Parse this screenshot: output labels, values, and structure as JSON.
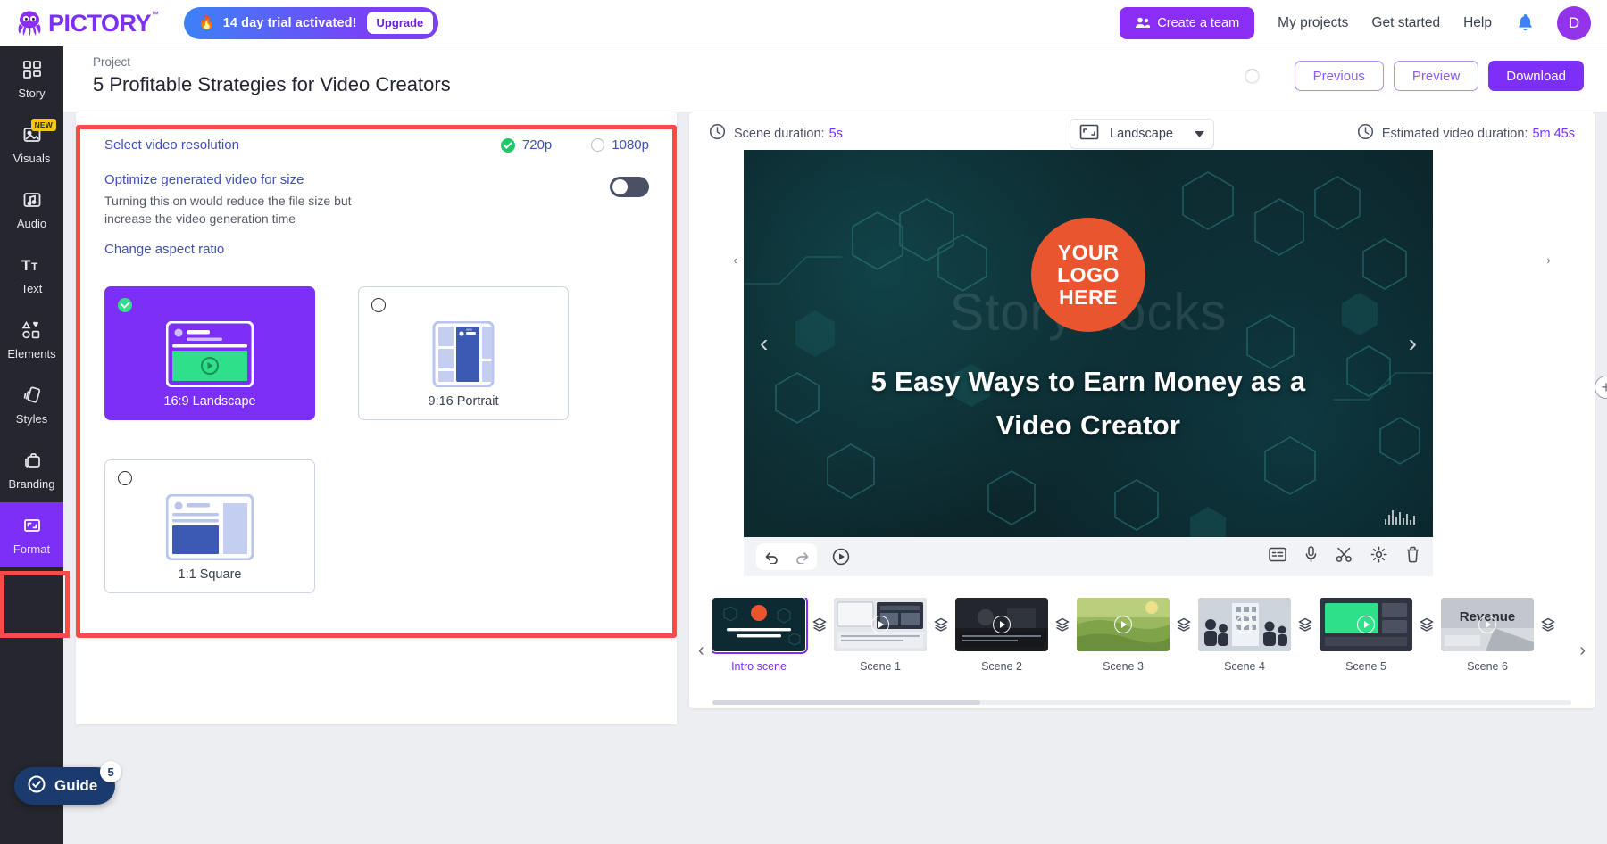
{
  "header": {
    "logo_text": "PICTORY",
    "logo_tm": "™",
    "trial_text": "14 day trial activated!",
    "upgrade_label": "Upgrade",
    "create_team_label": "Create a team",
    "nav": [
      {
        "label": "My projects"
      },
      {
        "label": "Get started"
      },
      {
        "label": "Help"
      }
    ],
    "avatar_initial": "D"
  },
  "sidebar": {
    "items": [
      {
        "label": "Story",
        "icon": "grid-icon",
        "badge": ""
      },
      {
        "label": "Visuals",
        "icon": "image-icon",
        "badge": "NEW"
      },
      {
        "label": "Audio",
        "icon": "music-icon",
        "badge": ""
      },
      {
        "label": "Text",
        "icon": "text-icon",
        "badge": ""
      },
      {
        "label": "Elements",
        "icon": "shapes-icon",
        "badge": ""
      },
      {
        "label": "Styles",
        "icon": "styles-icon",
        "badge": ""
      },
      {
        "label": "Branding",
        "icon": "briefcase-icon",
        "badge": ""
      },
      {
        "label": "Format",
        "icon": "format-icon",
        "badge": ""
      }
    ],
    "active_index": 7,
    "guide_label": "Guide",
    "guide_count": "5"
  },
  "project": {
    "kicker": "Project",
    "title": "5 Profitable Strategies for Video Creators",
    "actions": {
      "previous": "Previous",
      "preview": "Preview",
      "download": "Download"
    }
  },
  "format_panel": {
    "resolution_label": "Select video resolution",
    "resolution_options": [
      {
        "label": "720p",
        "selected": true
      },
      {
        "label": "1080p",
        "selected": false
      }
    ],
    "optimize_title": "Optimize generated video for size",
    "optimize_desc": "Turning this on would reduce the file size but increase the video generation time",
    "optimize_on": false,
    "aspect_link": "Change aspect ratio",
    "aspect_cards": [
      {
        "label": "16:9 Landscape",
        "selected": true
      },
      {
        "label": "9:16 Portrait",
        "selected": false
      },
      {
        "label": "1:1 Square",
        "selected": false
      }
    ]
  },
  "editor": {
    "scene_duration_label": "Scene duration:",
    "scene_duration_value": "5s",
    "ratio_select_value": "Landscape",
    "estimated_label": "Estimated video duration:",
    "estimated_value": "5m 45s",
    "preview": {
      "logo_line1": "YOUR",
      "logo_line2": "LOGO",
      "logo_line3": "HERE",
      "title_line1": "5 Easy Ways to Earn Money as a",
      "title_line2": "Video Creator",
      "watermark": "Storyblocks"
    },
    "controls": {
      "undo": "undo-icon",
      "redo": "redo-icon",
      "play": "play-icon",
      "subtitle": "subtitle-icon",
      "voice": "microphone-icon",
      "cut": "scissors-icon",
      "settings": "gear-icon",
      "delete": "trash-icon"
    },
    "scenes": [
      {
        "label": "Intro scene",
        "active": true
      },
      {
        "label": "Scene 1",
        "active": false
      },
      {
        "label": "Scene 2",
        "active": false
      },
      {
        "label": "Scene 3",
        "active": false
      },
      {
        "label": "Scene 4",
        "active": false
      },
      {
        "label": "Scene 5",
        "active": false
      },
      {
        "label": "Scene 6",
        "active": false
      }
    ]
  },
  "colors": {
    "brand_purple": "#7b2ff7",
    "accent_green": "#20c767",
    "highlight_red": "#fb4a4a",
    "rail_dark": "#25262e",
    "link_blue": "#3f51b5"
  }
}
